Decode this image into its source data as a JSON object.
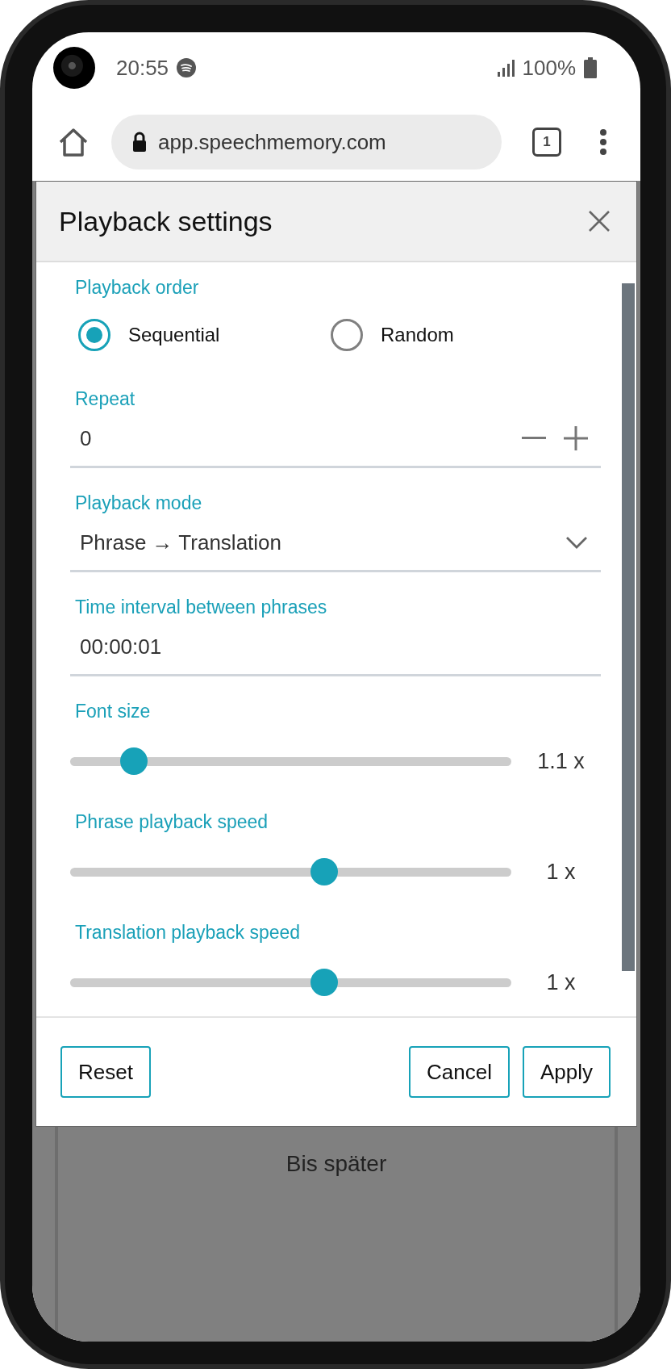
{
  "status_bar": {
    "time": "20:55",
    "battery": "100%"
  },
  "browser": {
    "url": "app.speechmemory.com",
    "tab_count": "1"
  },
  "dialog": {
    "title": "Playback settings",
    "playback_order": {
      "label": "Playback order",
      "options": [
        {
          "label": "Sequential",
          "selected": true
        },
        {
          "label": "Random",
          "selected": false
        }
      ]
    },
    "repeat": {
      "label": "Repeat",
      "value": "0"
    },
    "mode": {
      "label": "Playback mode",
      "value": "Phrase → Translation"
    },
    "interval": {
      "label": "Time interval between phrases",
      "value": "00:00:01"
    },
    "sliders": [
      {
        "label": "Font size",
        "level": 0.12,
        "reading": "1.1 x"
      },
      {
        "label": "Phrase playback speed",
        "level": 0.58,
        "reading": "1 x"
      },
      {
        "label": "Translation playback speed",
        "level": 0.58,
        "reading": "1 x"
      }
    ],
    "reset_button": "Reset",
    "action_buttons": [
      "Cancel",
      "Apply"
    ]
  },
  "background": {
    "text": "Bis später"
  }
}
